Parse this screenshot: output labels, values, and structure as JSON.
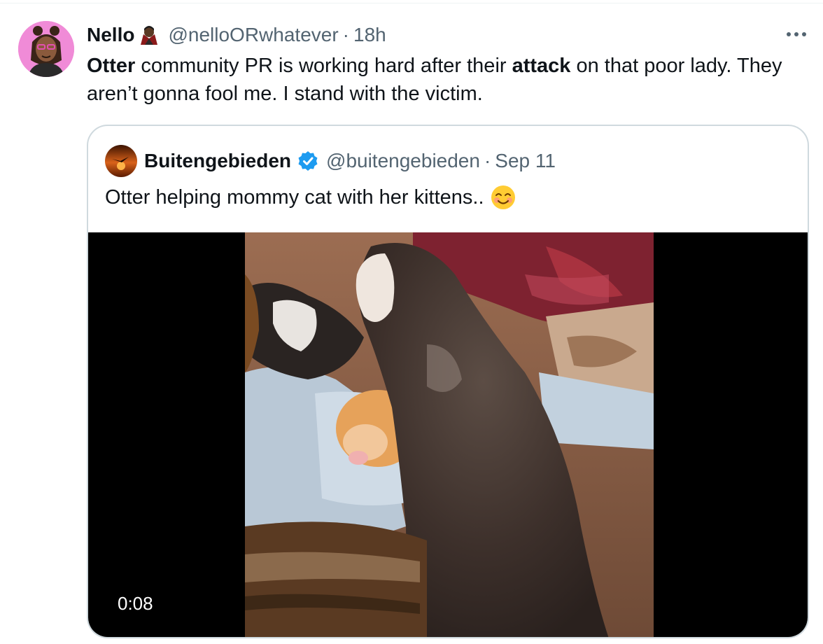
{
  "tweet": {
    "author_name": "Nello",
    "handle": "@nelloORwhatever",
    "separator": "·",
    "time": "18h",
    "text_bold_1": "Otter",
    "text_1": " community PR is working hard after their ",
    "text_bold_2": "attack",
    "text_2": " on that poor lady. They aren’t gonna fool me. I stand with the victim.",
    "avatar_bg": "#f08bd7"
  },
  "quoted": {
    "author_name": "Buitengebieden",
    "handle": "@buitengebieden",
    "separator": "·",
    "date": "Sep 11",
    "text": "Otter helping mommy cat with her kittens..",
    "verified_color": "#1d9bf0",
    "video": {
      "duration": "0:08"
    }
  },
  "icons": [
    "more-icon",
    "vampire-emoji-icon",
    "verified-badge-icon",
    "smiling-face-emoji-icon",
    "play-video"
  ]
}
